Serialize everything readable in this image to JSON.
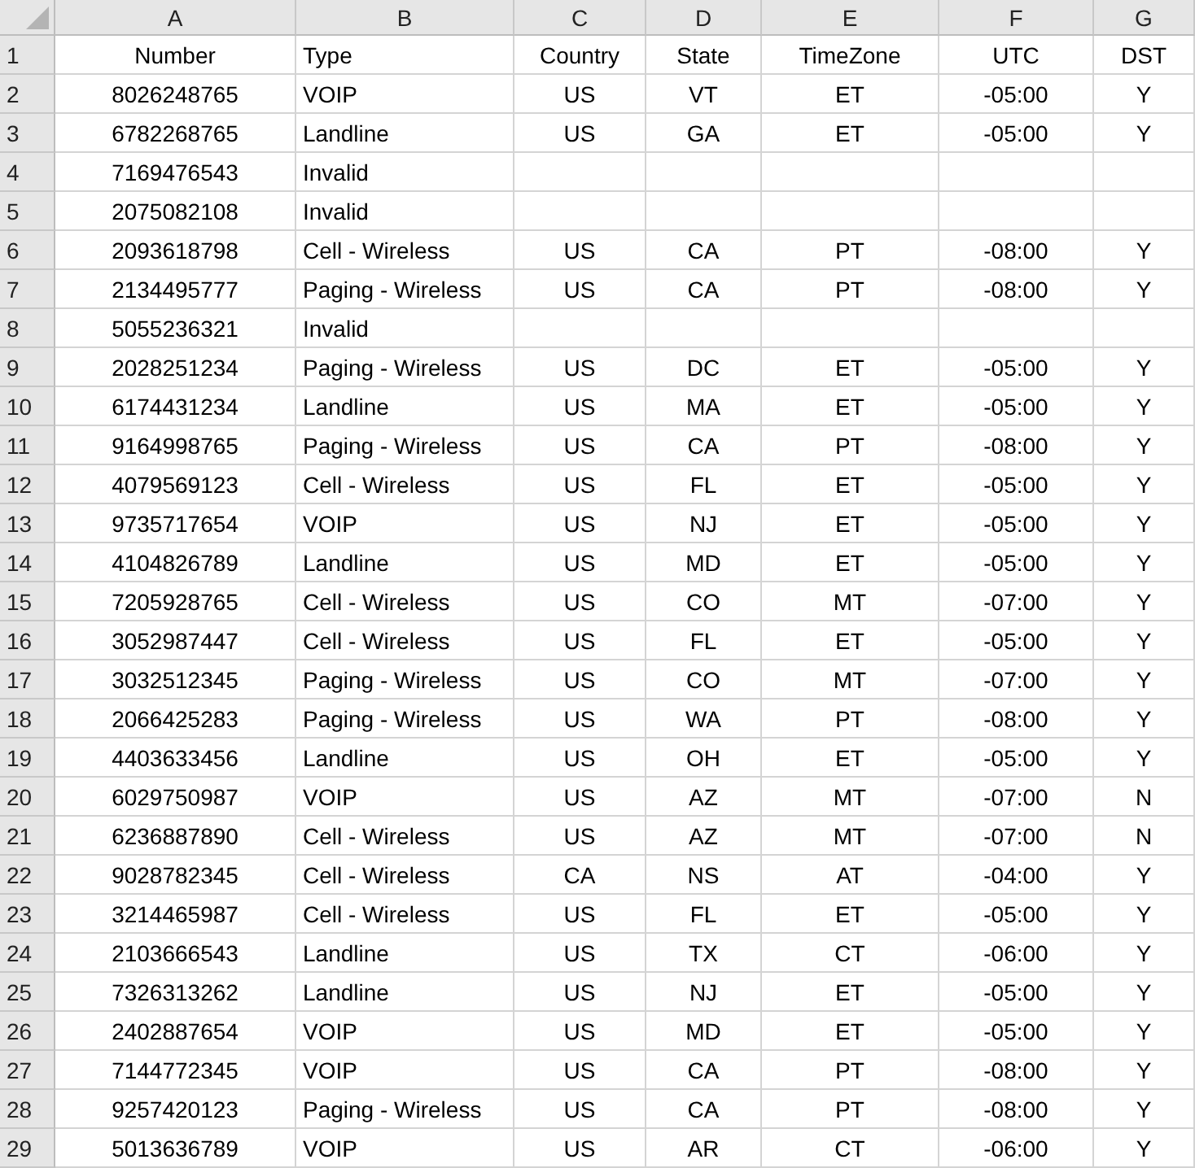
{
  "columns": [
    "A",
    "B",
    "C",
    "D",
    "E",
    "F",
    "G"
  ],
  "rows": [
    {
      "n": "1",
      "cells": [
        "Number",
        "Type",
        "Country",
        "State",
        "TimeZone",
        "UTC",
        "DST"
      ]
    },
    {
      "n": "2",
      "cells": [
        "8026248765",
        "VOIP",
        "US",
        "VT",
        "ET",
        "-05:00",
        "Y"
      ]
    },
    {
      "n": "3",
      "cells": [
        "6782268765",
        "Landline",
        "US",
        "GA",
        "ET",
        "-05:00",
        "Y"
      ]
    },
    {
      "n": "4",
      "cells": [
        "7169476543",
        "Invalid"
      ]
    },
    {
      "n": "5",
      "cells": [
        "2075082108",
        "Invalid"
      ]
    },
    {
      "n": "6",
      "cells": [
        "2093618798",
        "Cell - Wireless",
        "US",
        "CA",
        "PT",
        "-08:00",
        "Y"
      ]
    },
    {
      "n": "7",
      "cells": [
        "2134495777",
        "Paging - Wireless",
        "US",
        "CA",
        "PT",
        "-08:00",
        "Y"
      ]
    },
    {
      "n": "8",
      "cells": [
        "5055236321",
        "Invalid"
      ]
    },
    {
      "n": "9",
      "cells": [
        "2028251234",
        "Paging - Wireless",
        "US",
        "DC",
        "ET",
        "-05:00",
        "Y"
      ]
    },
    {
      "n": "10",
      "cells": [
        "6174431234",
        "Landline",
        "US",
        "MA",
        "ET",
        "-05:00",
        "Y"
      ]
    },
    {
      "n": "11",
      "cells": [
        "9164998765",
        "Paging - Wireless",
        "US",
        "CA",
        "PT",
        "-08:00",
        "Y"
      ]
    },
    {
      "n": "12",
      "cells": [
        "4079569123",
        "Cell - Wireless",
        "US",
        "FL",
        "ET",
        "-05:00",
        "Y"
      ]
    },
    {
      "n": "13",
      "cells": [
        "9735717654",
        "VOIP",
        "US",
        "NJ",
        "ET",
        "-05:00",
        "Y"
      ]
    },
    {
      "n": "14",
      "cells": [
        "4104826789",
        "Landline",
        "US",
        "MD",
        "ET",
        "-05:00",
        "Y"
      ]
    },
    {
      "n": "15",
      "cells": [
        "7205928765",
        "Cell - Wireless",
        "US",
        "CO",
        "MT",
        "-07:00",
        "Y"
      ]
    },
    {
      "n": "16",
      "cells": [
        "3052987447",
        "Cell - Wireless",
        "US",
        "FL",
        "ET",
        "-05:00",
        "Y"
      ]
    },
    {
      "n": "17",
      "cells": [
        "3032512345",
        "Paging - Wireless",
        "US",
        "CO",
        "MT",
        "-07:00",
        "Y"
      ]
    },
    {
      "n": "18",
      "cells": [
        "2066425283",
        "Paging - Wireless",
        "US",
        "WA",
        "PT",
        "-08:00",
        "Y"
      ]
    },
    {
      "n": "19",
      "cells": [
        "4403633456",
        "Landline",
        "US",
        "OH",
        "ET",
        "-05:00",
        "Y"
      ]
    },
    {
      "n": "20",
      "cells": [
        "6029750987",
        "VOIP",
        "US",
        "AZ",
        "MT",
        "-07:00",
        "N"
      ]
    },
    {
      "n": "21",
      "cells": [
        "6236887890",
        "Cell - Wireless",
        "US",
        "AZ",
        "MT",
        "-07:00",
        "N"
      ]
    },
    {
      "n": "22",
      "cells": [
        "9028782345",
        "Cell - Wireless",
        "CA",
        "NS",
        "AT",
        "-04:00",
        "Y"
      ]
    },
    {
      "n": "23",
      "cells": [
        "3214465987",
        "Cell - Wireless",
        "US",
        "FL",
        "ET",
        "-05:00",
        "Y"
      ]
    },
    {
      "n": "24",
      "cells": [
        "2103666543",
        "Landline",
        "US",
        "TX",
        "CT",
        "-06:00",
        "Y"
      ]
    },
    {
      "n": "25",
      "cells": [
        "7326313262",
        "Landline",
        "US",
        "NJ",
        "ET",
        "-05:00",
        "Y"
      ]
    },
    {
      "n": "26",
      "cells": [
        "2402887654",
        "VOIP",
        "US",
        "MD",
        "ET",
        "-05:00",
        "Y"
      ]
    },
    {
      "n": "27",
      "cells": [
        "7144772345",
        "VOIP",
        "US",
        "CA",
        "PT",
        "-08:00",
        "Y"
      ]
    },
    {
      "n": "28",
      "cells": [
        "9257420123",
        "Paging - Wireless",
        "US",
        "CA",
        "PT",
        "-08:00",
        "Y"
      ]
    },
    {
      "n": "29",
      "cells": [
        "5013636789",
        "VOIP",
        "US",
        "AR",
        "CT",
        "-06:00",
        "Y"
      ]
    }
  ]
}
